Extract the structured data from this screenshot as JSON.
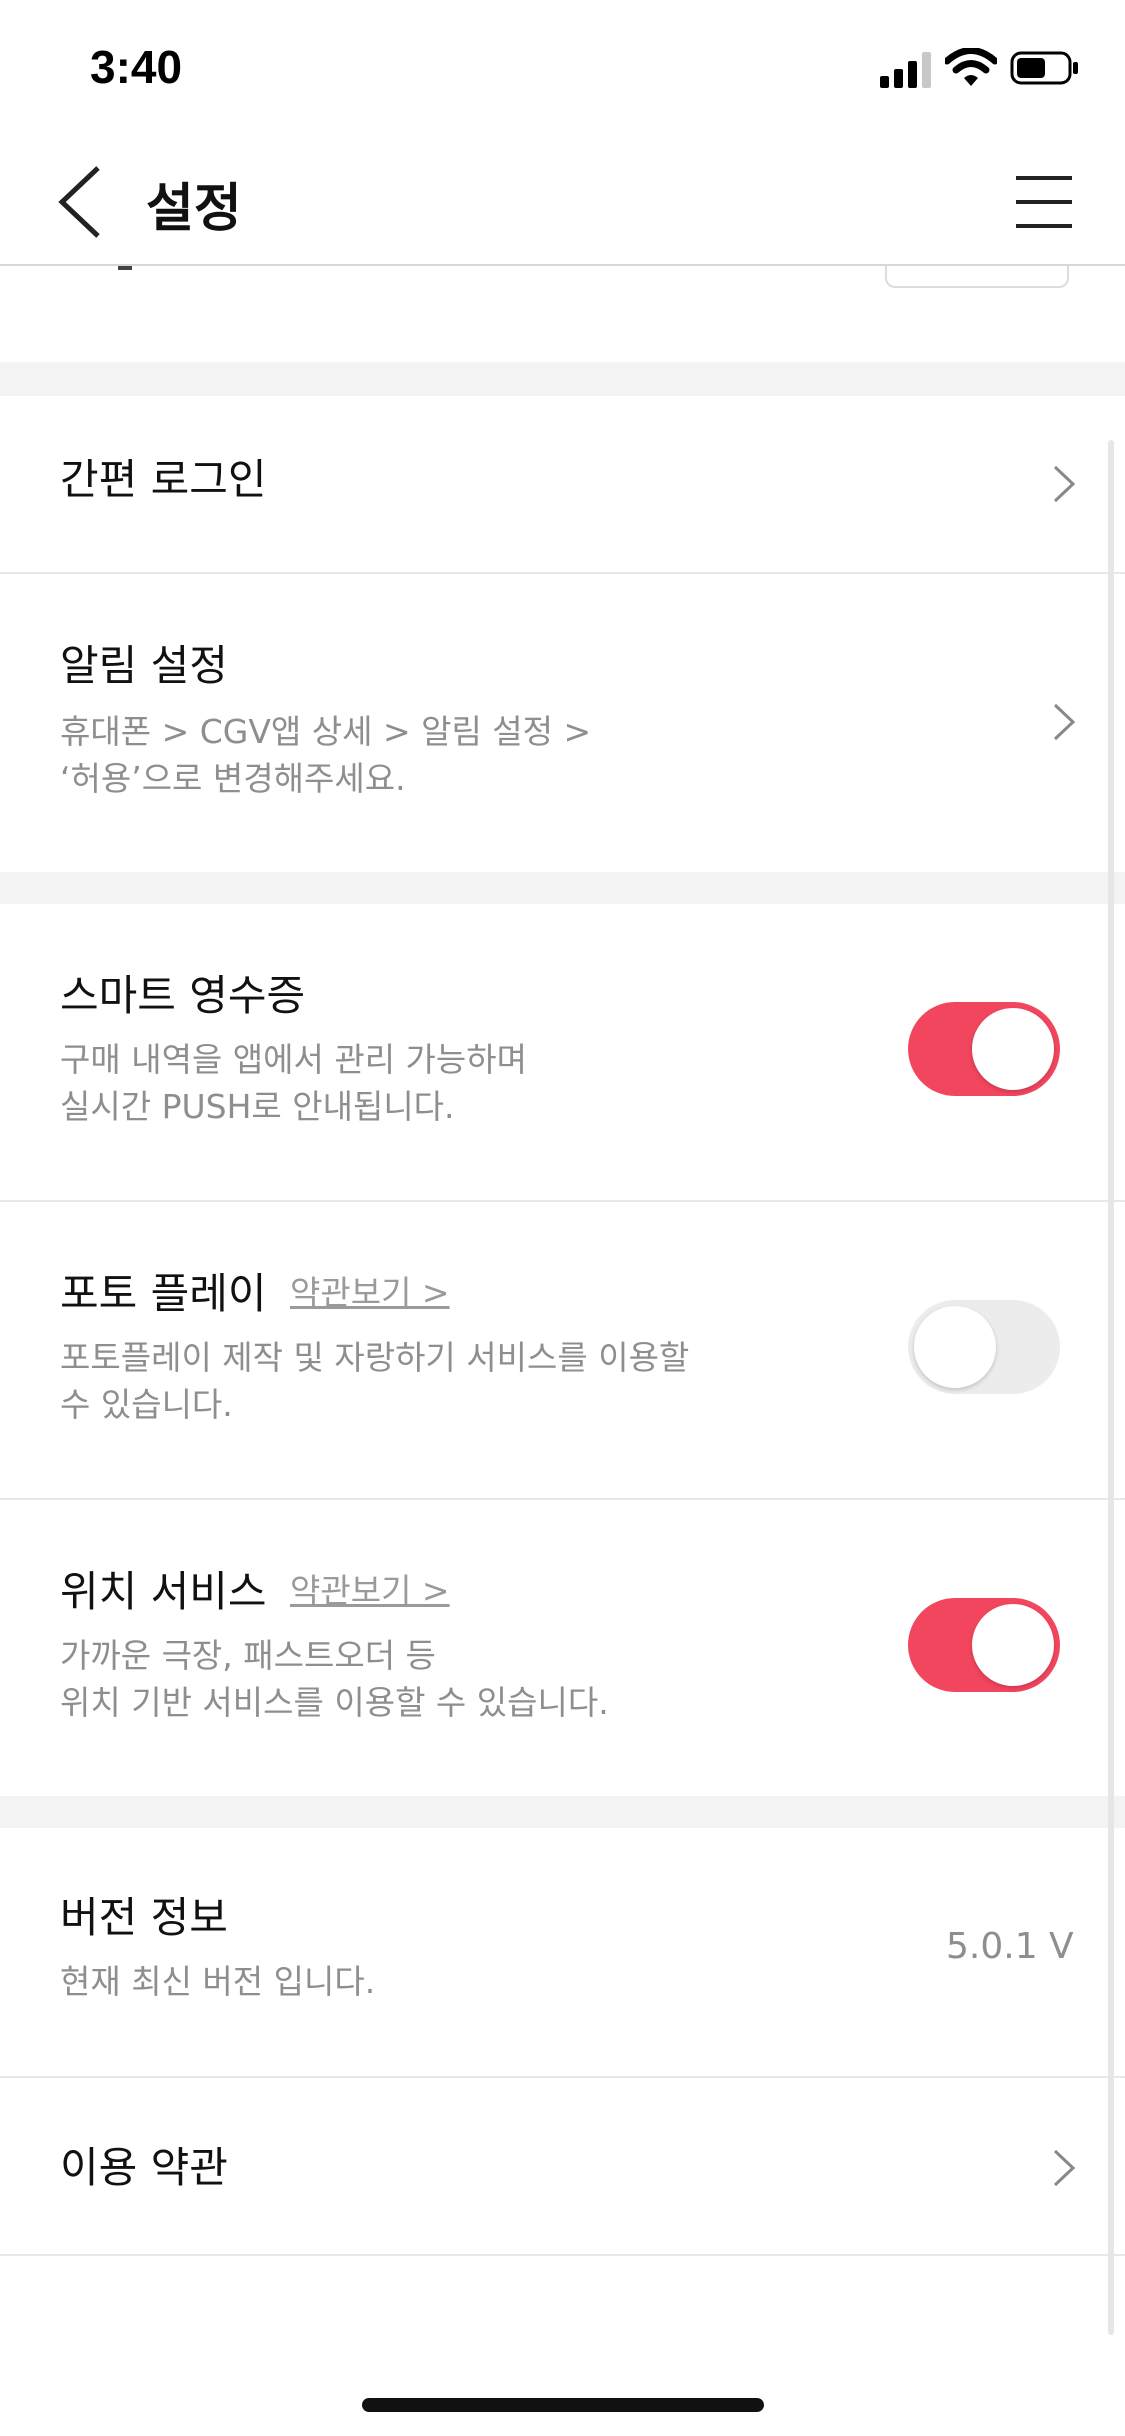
{
  "status_bar": {
    "time": "3:40"
  },
  "header": {
    "title": "설정"
  },
  "settings": {
    "easy_login": {
      "label": "간편 로그인"
    },
    "notification": {
      "label": "알림 설정",
      "desc": "휴대폰 > CGV앱 상세 > 알림 설정 >\n‘허용’으로 변경해주세요."
    },
    "smart_receipt": {
      "label": "스마트 영수증",
      "desc": "구매 내역을 앱에서 관리 가능하며\n실시간 PUSH로 안내됩니다.",
      "enabled": true
    },
    "photo_play": {
      "label": "포토 플레이",
      "terms_link": "약관보기 >",
      "desc": "포토플레이 제작 및 자랑하기 서비스를 이용할\n수 있습니다.",
      "enabled": false
    },
    "location": {
      "label": "위치 서비스",
      "terms_link": "약관보기 >",
      "desc": "가까운 극장, 패스트오더 등\n위치 기반 서비스를 이용할 수 있습니다.",
      "enabled": true
    },
    "version": {
      "label": "버전 정보",
      "desc": "현재 최신 버전 입니다.",
      "value": "5.0.1 V"
    },
    "terms": {
      "label": "이용 약관"
    }
  },
  "colors": {
    "accent": "#f2465e",
    "toggle_off": "#ececec",
    "muted_text": "#8e8e8e",
    "section_gap": "#f3f3f3"
  }
}
